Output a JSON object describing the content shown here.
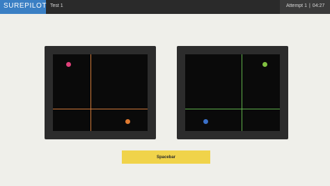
{
  "header": {
    "brand": "SUREPILOT",
    "test_name": "Test 1",
    "attempt": "Attempt 1",
    "separator": "|",
    "timer": "04:27"
  },
  "colors": {
    "brand_bg": "#3a7fc4",
    "left_crosshair": "#d07a3a",
    "right_crosshair": "#5fb04a",
    "pink_dot": "#e0407a",
    "orange_dot": "#e07a30",
    "green_dot": "#80c040",
    "blue_dot": "#3a70c8",
    "button": "#f0d34a"
  },
  "controls": {
    "spacebar_label": "Spacebar"
  }
}
